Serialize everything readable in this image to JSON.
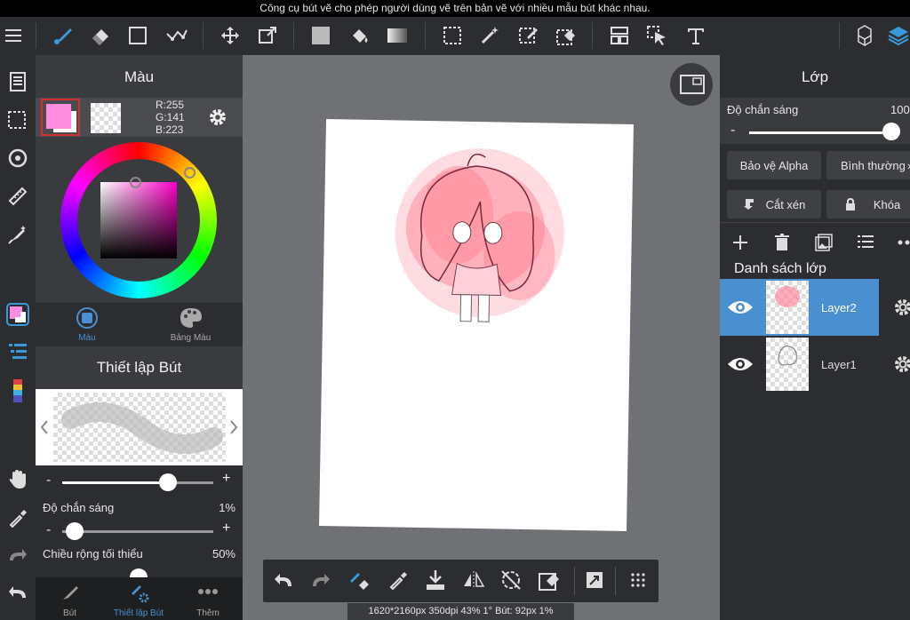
{
  "caption": "Công cụ bút vẽ cho phép người dùng vẽ trên bản vẽ với nhiều mẫu bút khác nhau.",
  "colorPanel": {
    "title": "Màu",
    "rgb": {
      "r": "R:255",
      "g": "G:141",
      "b": "B:223"
    },
    "primaryColor": "#ff8ddf",
    "tabs": [
      {
        "label": "Màu",
        "active": true
      },
      {
        "label": "Bảng Màu",
        "active": false
      }
    ]
  },
  "brushPanel": {
    "title": "Thiết lập Bút",
    "opacity": {
      "label": "Độ chắn sáng",
      "value": "1%"
    },
    "minWidth": {
      "label": "Chiều rộng tối thiểu",
      "value": "50%"
    },
    "sizeLevel": 0.75,
    "opacityLevel": 0.01
  },
  "bottomTabs": [
    {
      "label": "Bút",
      "active": false
    },
    {
      "label": "Thiết lập Bút",
      "active": true
    },
    {
      "label": "Thêm",
      "active": false
    }
  ],
  "layerPanel": {
    "title": "Lớp",
    "opacity": {
      "label": "Độ chắn sáng",
      "value": "100"
    },
    "opacityLevel": 1.0,
    "alphaProtect": "Bảo vệ Alpha",
    "blendMode": "Bình thường",
    "clipping": "Cắt xén",
    "lock": "Khóa",
    "listTitle": "Danh sách lớp",
    "layers": [
      {
        "name": "Layer2",
        "selected": true
      },
      {
        "name": "Layer1",
        "selected": false
      }
    ]
  },
  "status": "1620*2160px 350dpi 43% 1° Bút: 92px 1%",
  "colors": {
    "accent": "#4a90d0",
    "selectedLayer": "#4a90d0",
    "activeTab": "#4a90d0"
  }
}
